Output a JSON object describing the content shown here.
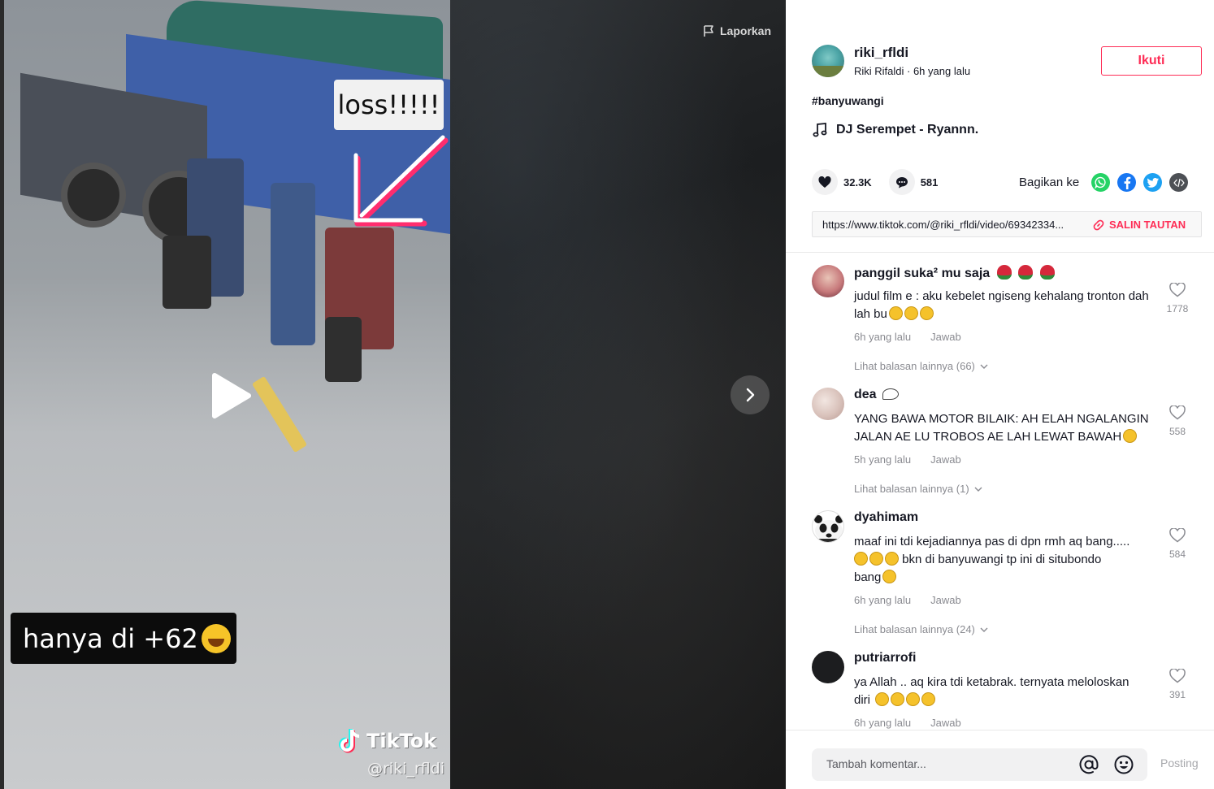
{
  "video": {
    "overlay_top_text": "loss!!!!!",
    "overlay_caption": "hanya di +62",
    "watermark_brand": "TikTok",
    "watermark_handle": "@riki_rfldi",
    "report_label": "Laporkan"
  },
  "author": {
    "username": "riki_rfldi",
    "subtitle": "Riki Rifaldi · 6h yang lalu",
    "follow_label": "Ikuti"
  },
  "post": {
    "hashtag": "#banyuwangi",
    "music": "DJ Serempet - Ryannn."
  },
  "stats": {
    "likes": "32.3K",
    "comments": "581",
    "share_label": "Bagikan ke"
  },
  "share": {
    "icons": [
      "whatsapp-icon",
      "facebook-icon",
      "twitter-icon",
      "embed-icon"
    ],
    "colors": {
      "whatsapp": "#25d366",
      "facebook": "#1877f2",
      "twitter": "#1da1f2",
      "embed": "#4d5055"
    },
    "link": "https://www.tiktok.com/@riki_rfldi/video/69342334...",
    "copy_label": "SALIN TAUTAN"
  },
  "comments": [
    {
      "name": "panggil suka² mu saja",
      "text": "judul film e : aku kebelet ngiseng kehalang tronton dah lah bu",
      "time": "6h yang lalu",
      "reply": "Jawab",
      "likes": "1778",
      "more": "Lihat balasan lainnya (66)"
    },
    {
      "name": "dea",
      "text": "YANG BAWA MOTOR BILAIK: AH ELAH NGALANGIN JALAN AE LU TROBOS AE LAH LEWAT BAWAH",
      "time": "5h yang lalu",
      "reply": "Jawab",
      "likes": "558",
      "more": "Lihat balasan lainnya (1)"
    },
    {
      "name": "dyahimam",
      "text_line1": "maaf ini tdi kejadiannya pas di dpn rmh aq bang.....",
      "text_line2": "bkn di banyuwangi tp ini di situbondo",
      "text_line3": "bang",
      "time": "6h yang lalu",
      "reply": "Jawab",
      "likes": "584",
      "more": "Lihat balasan lainnya (24)"
    },
    {
      "name": "putriarrofi",
      "text_line1": "ya Allah .. aq kira tdi ketabrak. ternyata meloloskan",
      "text_line2": "diri",
      "time": "6h yang lalu",
      "reply": "Jawab",
      "likes": "391"
    }
  ],
  "composer": {
    "placeholder": "Tambah komentar...",
    "post_label": "Posting"
  },
  "colors": {
    "accent": "#fe2c55",
    "text": "#161823",
    "muted": "#8a8b91"
  }
}
